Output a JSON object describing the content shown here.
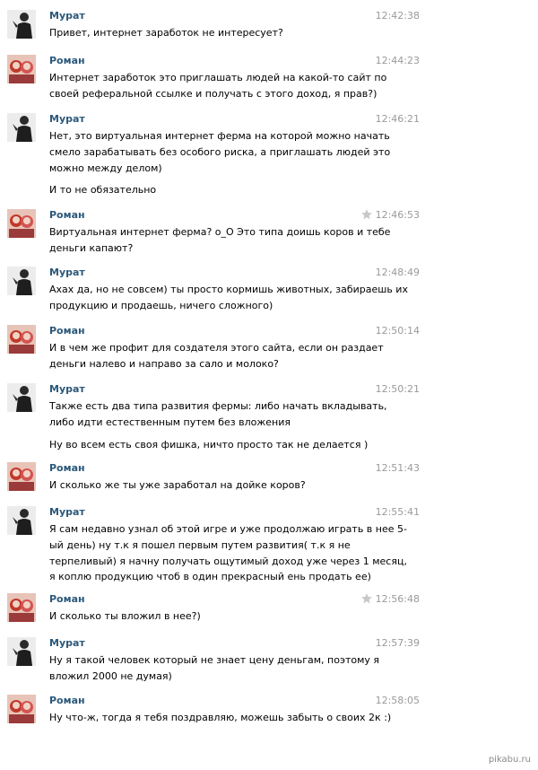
{
  "messages": [
    {
      "sender": "Мурат",
      "time": "12:42:38",
      "lines": [
        "Привет, интернет заработок не интересует?"
      ],
      "extra": []
    },
    {
      "sender": "Роман",
      "time": "12:44:23",
      "lines": [
        "Интернет заработок это приглашать людей на какой-то сайт по",
        "своей реферальной ссылке и получать с этого доход, я прав?)"
      ],
      "extra": []
    },
    {
      "sender": "Мурат",
      "time": "12:46:21",
      "lines": [
        "Нет, это виртуальная интернет ферма на которой можно начать",
        "смело зарабатывать без особого риска, а приглашать людей это",
        "можно между делом)"
      ],
      "extra": [
        "И то не обязательно"
      ]
    },
    {
      "sender": "Роман",
      "time": "12:46:53",
      "starred": true,
      "lines": [
        "Виртуальная интернет ферма? о_О Это типа доишь коров и тебе",
        "деньги капают?"
      ],
      "extra": []
    },
    {
      "sender": "Мурат",
      "time": "12:48:49",
      "lines": [
        "Ахах да, но не совсем) ты просто кормишь животных, забираешь их",
        "продукцию и продаешь, ничего сложного)"
      ],
      "extra": []
    },
    {
      "sender": "Роман",
      "time": "12:50:14",
      "lines": [
        "И в чем же профит для создателя этого сайта, если он раздает",
        "деньги налево и направо за сало и молоко?"
      ],
      "extra": []
    },
    {
      "sender": "Мурат",
      "time": "12:50:21",
      "lines": [
        "Также есть два типа развития фермы: либо начать вкладывать,",
        "либо идти естественным путем без вложения"
      ],
      "extra": [
        "Ну во всем есть своя фишка, ничто просто так не делается )"
      ]
    },
    {
      "sender": "Роман",
      "time": "12:51:43",
      "lines": [
        "И сколько же ты уже заработал на дойке коров?"
      ],
      "extra": []
    },
    {
      "sender": "Мурат",
      "time": "12:55:41",
      "lines": [
        "Я сам недавно узнал об этой игре и уже продолжаю играть в нее 5-",
        "ый день) ну т.к я пошел первым путем развития( т.к я не",
        "терпеливый) я начну получать ощутимый доход уже через 1 месяц,",
        "я коплю продукцию чтоб в один прекрасный ень продать ее)"
      ],
      "extra": []
    },
    {
      "sender": "Роман",
      "time": "12:56:48",
      "starred": true,
      "lines": [
        "И сколько ты вложил в нее?)"
      ],
      "extra": []
    },
    {
      "sender": "Мурат",
      "time": "12:57:39",
      "lines": [
        "Ну я такой человек который не знает цену деньгам, поэтому я",
        "вложил 2000 не думая)"
      ],
      "extra": []
    },
    {
      "sender": "Роман",
      "time": "12:58:05",
      "lines": [
        "Ну что-ж, тогда я тебя поздравляю, можешь забыть о своих 2к :)"
      ],
      "extra": []
    }
  ],
  "watermark": "pikabu.ru",
  "colors": {
    "sender": "#2b587a",
    "time": "#9a9a9a",
    "star": "#c8c8c8"
  }
}
